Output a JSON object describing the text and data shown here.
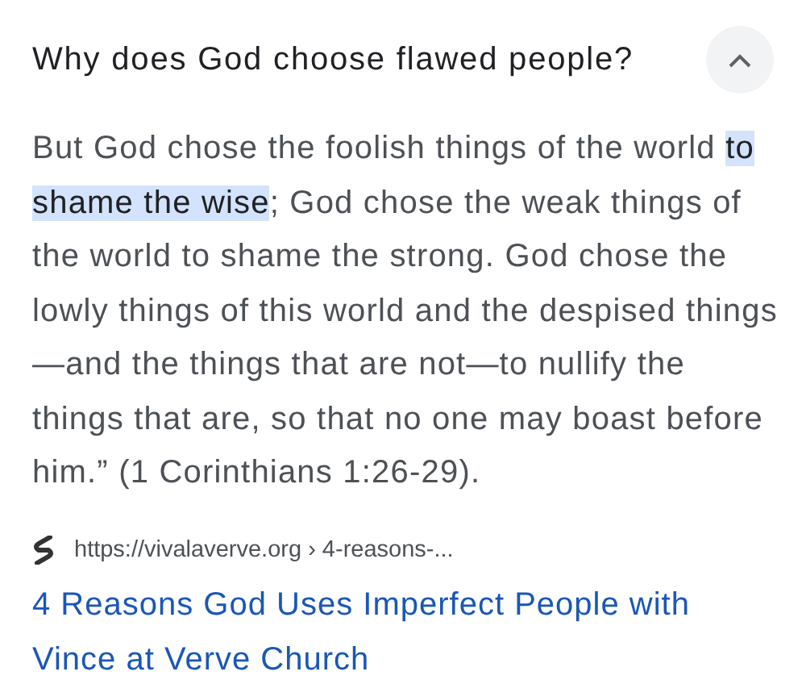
{
  "question": {
    "text": "Why does God choose flawed people?",
    "expanded": true
  },
  "answer": [
    {
      "text": "But God chose the foolish things of the world ",
      "highlighted": false
    },
    {
      "text": "to shame the wise",
      "highlighted": true
    },
    {
      "text": "; God chose the weak things of the world to shame the strong. God chose the lowly things of this world and the despised things—and the things that are not—to nullify the things that are, so that no one may boast before him.” (1 Corinthians 1:26-29).",
      "highlighted": false
    }
  ],
  "source": {
    "url": "https://vivalaverve.org › 4-reasons-...",
    "title": "4 Reasons God Uses Imperfect People with Vince at Verve Church"
  }
}
